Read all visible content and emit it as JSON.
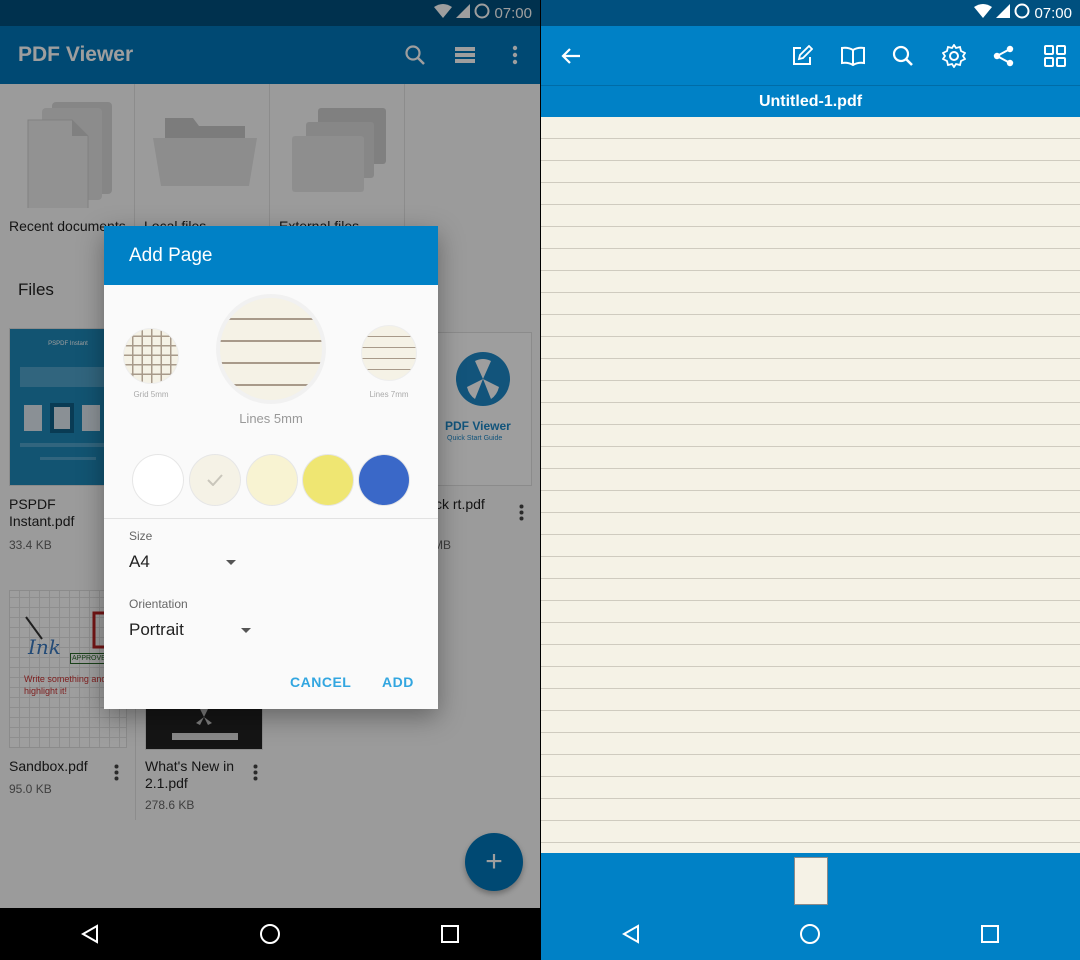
{
  "status": {
    "time": "07:00"
  },
  "left": {
    "appbar": {
      "title": "PDF Viewer",
      "icons": [
        "search-icon",
        "list-view-icon",
        "more-vert-icon"
      ]
    },
    "dirs": [
      {
        "label": "Recent documents"
      },
      {
        "label": "Local files"
      },
      {
        "label": "External files"
      }
    ],
    "files_heading": "Files",
    "files": [
      {
        "name": "PSPDF Instant.pdf",
        "size": "33.4 KB",
        "thumb_title": "PSPDF Instant"
      },
      {
        "name": "PSPDF Viewer Quick Start.pdf",
        "visible_name": "ck rt.pdf",
        "size": "MB",
        "thumb_title": "PDF Viewer",
        "thumb_sub": "Quick Start Guide"
      },
      {
        "name": "Sandbox.pdf",
        "size": "95.0 KB",
        "thumb_write": "Write something and highlight it!",
        "thumb_ink": "Ink",
        "thumb_approved": "APPROVED"
      },
      {
        "name": "What's New in 2.1.pdf",
        "size": "278.6 KB"
      }
    ],
    "fab": "+",
    "dialog": {
      "title": "Add Page",
      "patterns": [
        {
          "label": "Grid 5mm"
        },
        {
          "label": "Lines 5mm"
        },
        {
          "label": "Lines 7mm"
        }
      ],
      "selected_pattern": "Lines 5mm",
      "colors": [
        {
          "name": "white",
          "hex": "#ffffff"
        },
        {
          "name": "off-white",
          "hex": "#f5f2e6",
          "selected": true
        },
        {
          "name": "cream",
          "hex": "#f8f3d2"
        },
        {
          "name": "yellow",
          "hex": "#efe672"
        },
        {
          "name": "blue",
          "hex": "#3a68c8"
        }
      ],
      "size_label": "Size",
      "size_value": "A4",
      "orientation_label": "Orientation",
      "orientation_value": "Portrait",
      "cancel": "CANCEL",
      "add": "ADD"
    }
  },
  "right": {
    "toolbar_icons": [
      "back-arrow-icon",
      "edit-icon",
      "book-icon",
      "search-icon",
      "settings-icon",
      "share-icon",
      "grid-icon"
    ],
    "document_title": "Untitled-1.pdf"
  }
}
